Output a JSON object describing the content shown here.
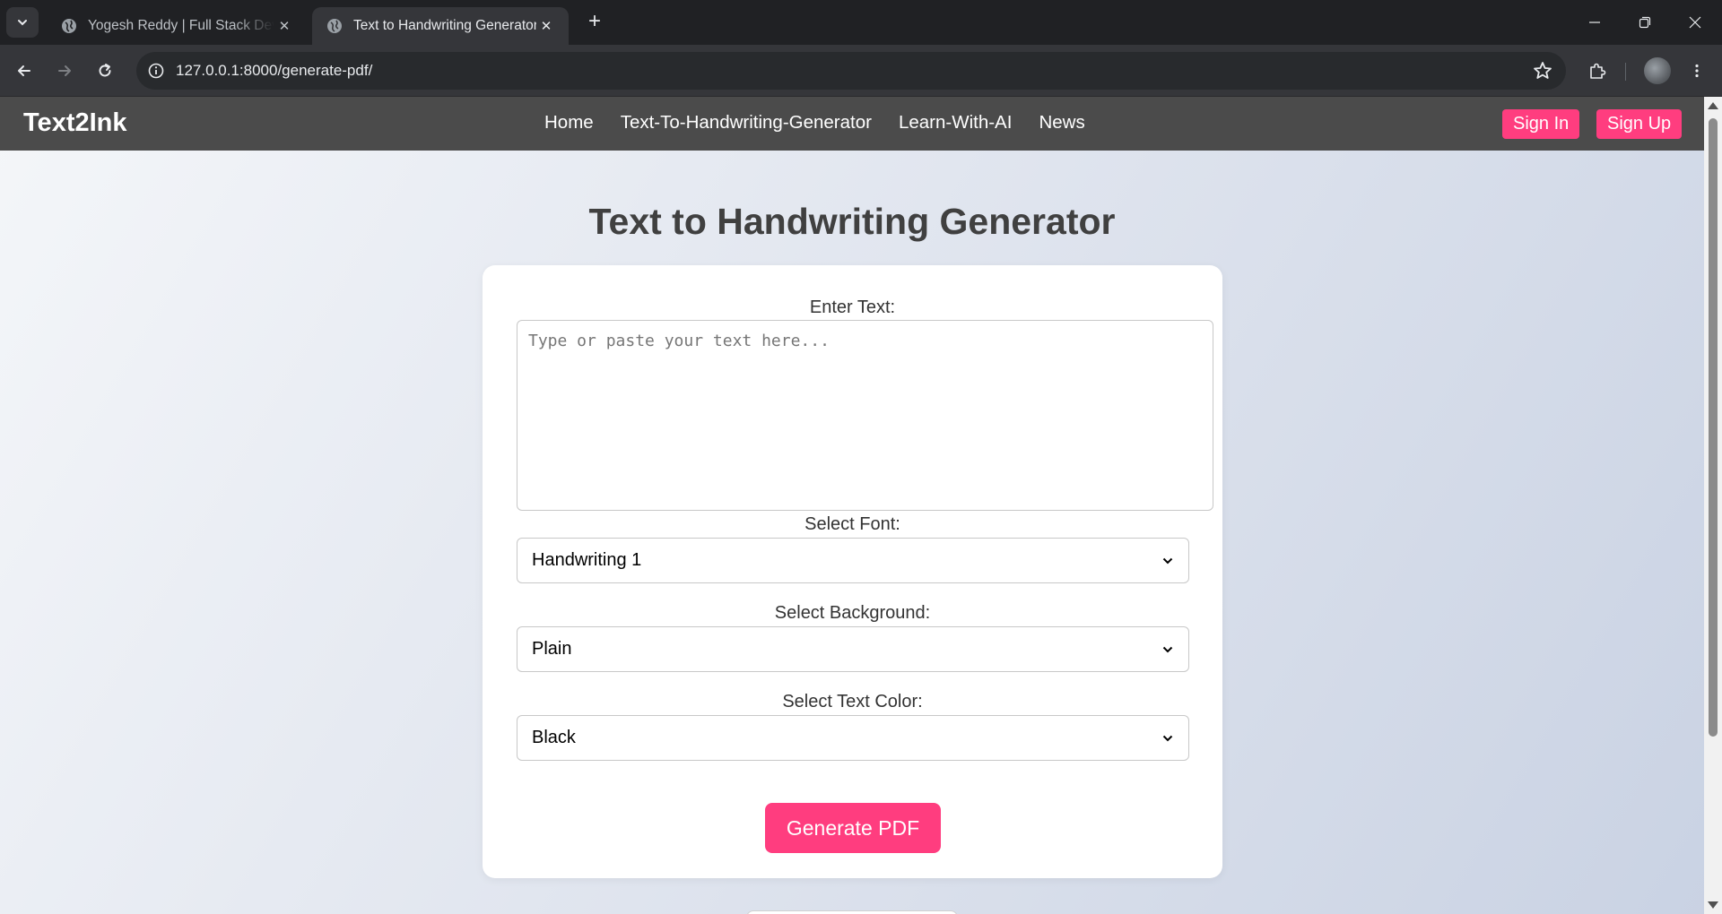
{
  "browser": {
    "tabs": [
      {
        "title": "Yogesh Reddy | Full Stack Developer",
        "active": false
      },
      {
        "title": "Text to Handwriting Generator",
        "active": true
      }
    ],
    "url": "127.0.0.1:8000/generate-pdf/"
  },
  "site": {
    "brand": "Text2Ink",
    "nav": [
      "Home",
      "Text-To-Handwriting-Generator",
      "Learn-With-AI",
      "News"
    ],
    "sign_in": "Sign In",
    "sign_up": "Sign Up",
    "accent_color": "#ff3d7f"
  },
  "form": {
    "title": "Text to Handwriting Generator",
    "text_label": "Enter Text:",
    "text_placeholder": "Type or paste your text here...",
    "font_label": "Select Font:",
    "font_value": "Handwriting 1",
    "background_label": "Select Background:",
    "background_value": "Plain",
    "color_label": "Select Text Color:",
    "color_value": "Black",
    "submit_label": "Generate PDF"
  }
}
